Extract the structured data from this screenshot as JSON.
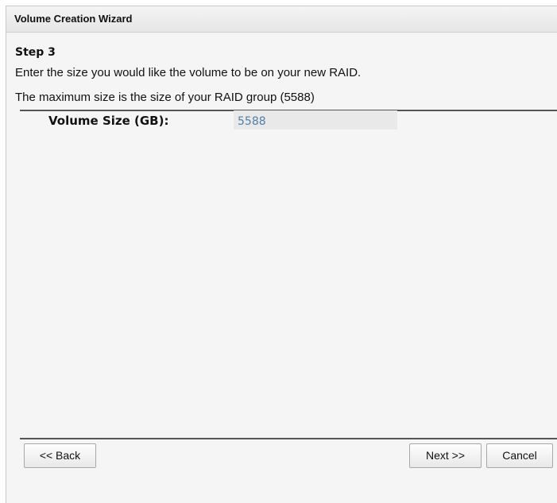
{
  "window": {
    "title": "Volume Creation Wizard"
  },
  "step": {
    "title": "Step 3",
    "instruction": "Enter the size you would like the volume to be on your new RAID.",
    "max_note": "The maximum size is the size of your RAID group (5588)"
  },
  "form": {
    "volume_size_label": "Volume Size (GB):",
    "volume_size_value": "5588"
  },
  "buttons": {
    "back": "<< Back",
    "next": "Next >>",
    "cancel": "Cancel"
  },
  "colors": {
    "field_text": "#4f7fa8",
    "field_background": "#e9e9e9",
    "dialog_background": "#f5f5f5"
  }
}
